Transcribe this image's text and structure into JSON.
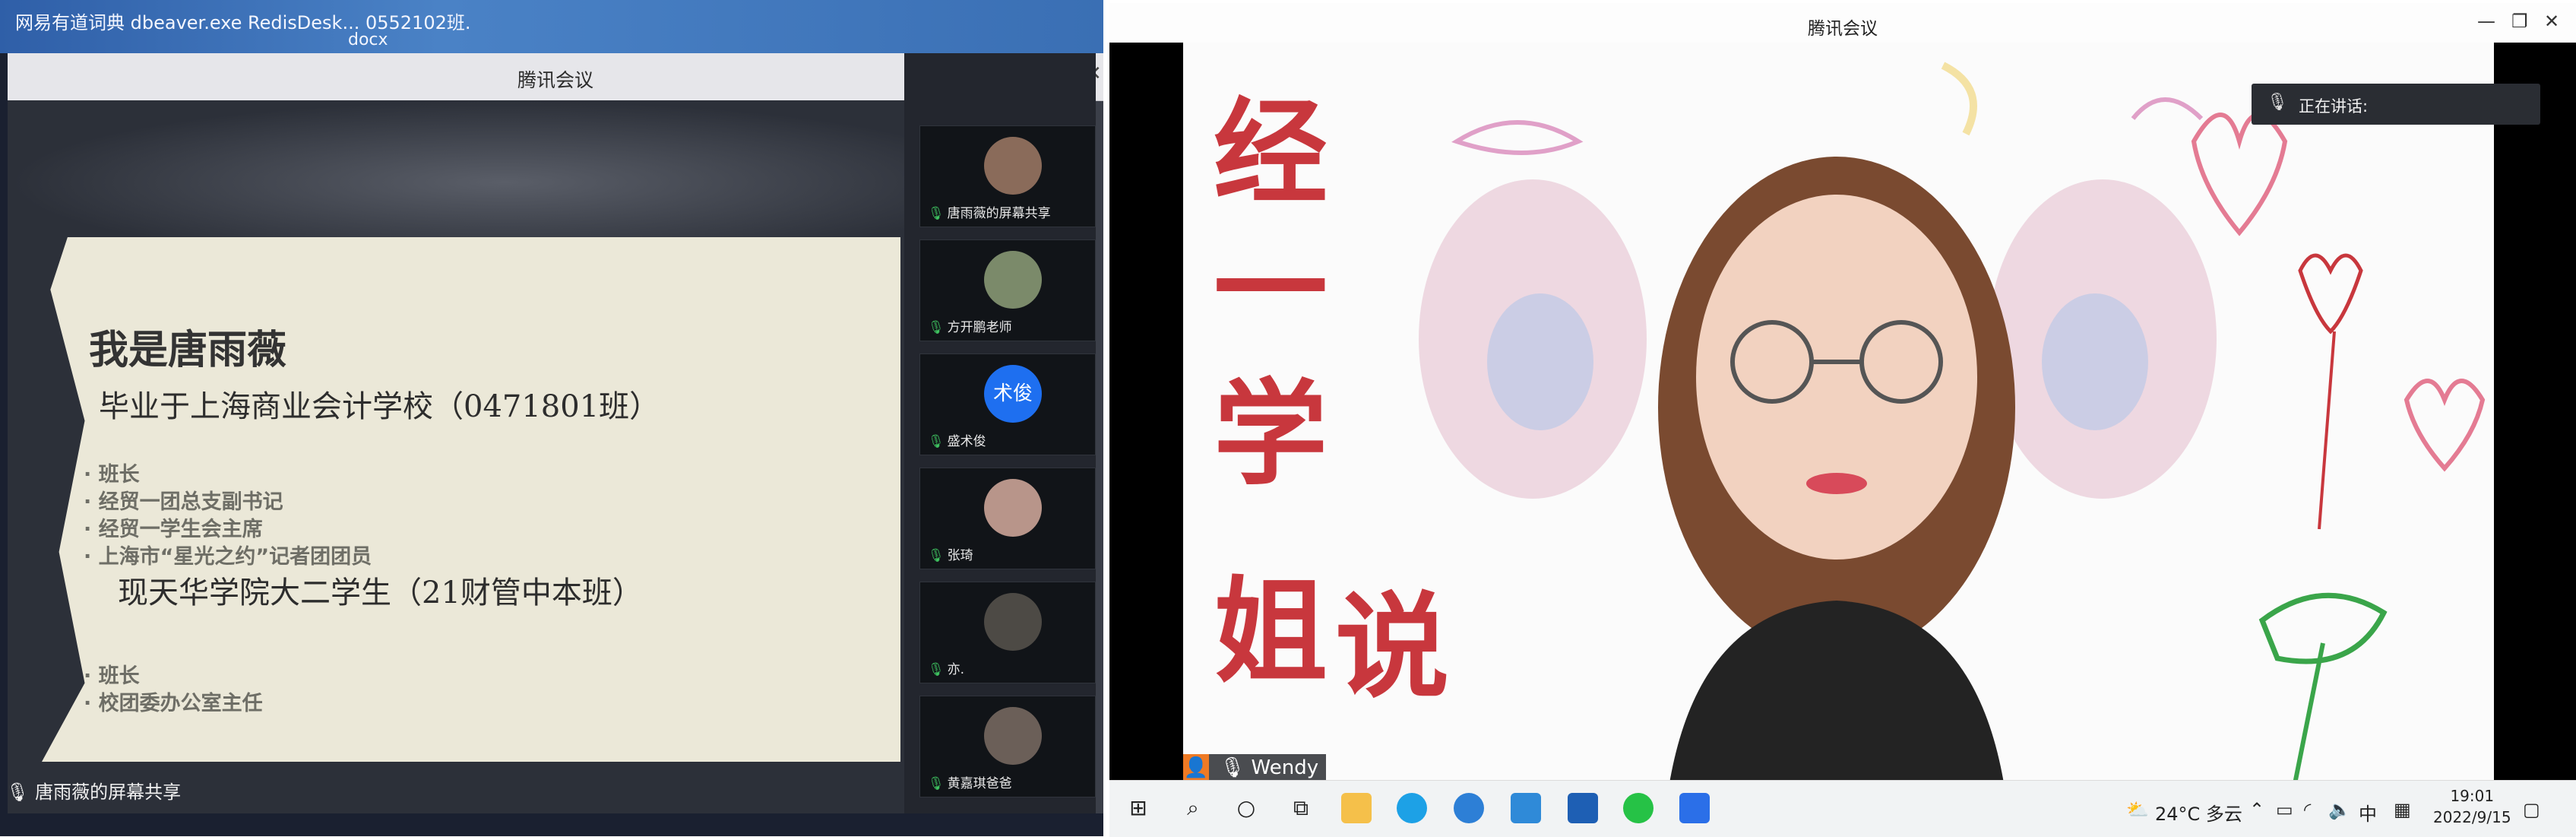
{
  "left_photo": {
    "desktop_text": "网易有道词典 dbeaver.exe RedisDesk...  0552102班.",
    "desktop_text_sub": "docx",
    "meeting_title": "腾讯会议",
    "slide": {
      "heading": "我是唐雨薇",
      "line1": "毕业于上海商业会计学校（0471801班）",
      "bullets1": [
        "· 班长",
        "· 经贸一团总支副书记",
        "· 经贸一学生会主席",
        "· 上海市“星光之约”记者团团员"
      ],
      "line2": "现天华学院大二学生（21财管中本班）",
      "bullets2": [
        "· 班长",
        "· 校团委办公室主任"
      ]
    },
    "share_label": "唐雨薇的屏幕共享",
    "participants": [
      {
        "name": "唐雨薇的屏幕共享",
        "avatar_color": "#8a6b5a"
      },
      {
        "name": "方开鹏老师",
        "avatar_color": "#7b8a6a"
      },
      {
        "name": "盛术俊",
        "avatar_text": "术俊",
        "avatar_color": "#1e6ff0"
      },
      {
        "name": "张琦",
        "avatar_color": "#b8958a"
      },
      {
        "name": "亦.",
        "avatar_color": "#4d4a45"
      },
      {
        "name": "黄嘉琪爸爸",
        "avatar_color": "#6b5f58"
      }
    ]
  },
  "right_window": {
    "title": "腾讯会议",
    "speaking_label": "正在讲话:",
    "calligraphy": [
      "经",
      "一",
      "学",
      "姐",
      "说"
    ],
    "name_tag": "Wendy",
    "taskbar": {
      "weather": "24°C  多云",
      "ime": "中",
      "time": "19:01",
      "date": "2022/9/15"
    }
  },
  "colors": {
    "tencent_orange": "#ef7a24",
    "calligraphy_red": "#c8373d",
    "speaking_bg": "#2a2d33"
  }
}
